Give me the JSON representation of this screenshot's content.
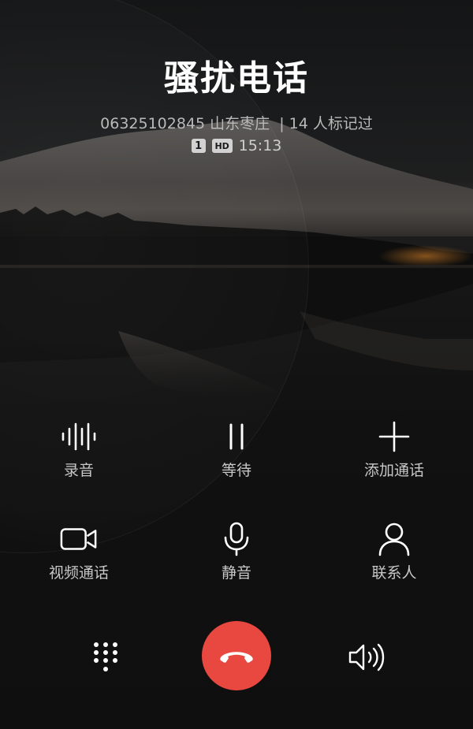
{
  "caller": {
    "name": "骚扰电话",
    "number": "06325102845",
    "location": "山东枣庄",
    "separator": "|",
    "tag_info": "14 人标记过",
    "sim_badge": "1",
    "hd_badge": "HD",
    "duration": "15:13"
  },
  "controls": [
    {
      "label": "录音",
      "icon": "waveform-icon"
    },
    {
      "label": "等待",
      "icon": "pause-icon"
    },
    {
      "label": "添加通话",
      "icon": "plus-icon"
    },
    {
      "label": "视频通话",
      "icon": "video-camera-icon"
    },
    {
      "label": "静音",
      "icon": "microphone-icon"
    },
    {
      "label": "联系人",
      "icon": "person-icon"
    }
  ],
  "bottom": {
    "dialpad_icon": "dialpad-icon",
    "end_call_icon": "hang-up-icon",
    "speaker_icon": "speaker-icon",
    "end_call_color": "#e8483f"
  },
  "colors": {
    "background": "#0f0f10",
    "text_primary": "#ffffff",
    "text_secondary": "#b9b9b9",
    "end_call": "#e8483f"
  }
}
